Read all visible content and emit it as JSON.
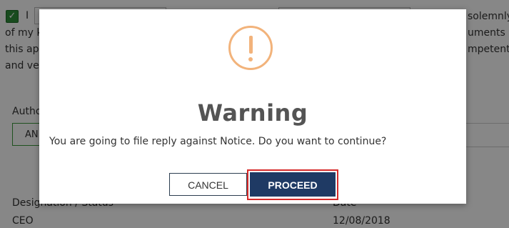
{
  "background": {
    "declaration_prefix": "I",
    "checkbox_mark": "✓",
    "declaration_lines": {
      "line1_left": "of my k",
      "line1_right": "uments a",
      "line2_left": "this ap",
      "line2_right": "mpetent",
      "line3_left": "and ve",
      "line0_right": "solemnly"
    },
    "authorized_label": "Autho",
    "authorized_select_value": "AN",
    "designation_label": "Designation / Status",
    "designation_value": "CEO",
    "date_label": "Date",
    "date_value": "12/08/2018"
  },
  "modal": {
    "icon": "exclamation-circle-icon",
    "title": "Warning",
    "message": "You are going to file reply against Notice. Do you want to continue?",
    "cancel_label": "CANCEL",
    "proceed_label": "PROCEED"
  },
  "colors": {
    "icon": "#f2b37b",
    "proceed_bg": "#1f3a64",
    "highlight": "#d62a2a",
    "checkbox": "#2f8f3a"
  }
}
